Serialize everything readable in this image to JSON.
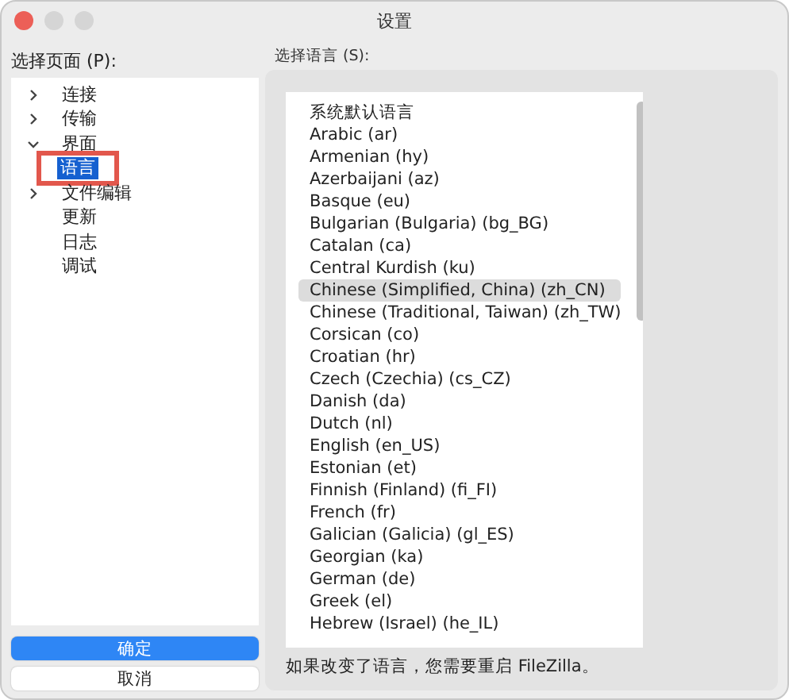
{
  "window": {
    "title": "设置"
  },
  "page_tree": {
    "label": "选择页面 (P):",
    "items": [
      {
        "label": "连接",
        "kind": "group",
        "expanded": false,
        "selected": false
      },
      {
        "label": "传输",
        "kind": "group",
        "expanded": false,
        "selected": false
      },
      {
        "label": "界面",
        "kind": "group",
        "expanded": true,
        "selected": false,
        "children": [
          {
            "label": "语言",
            "selected": true,
            "highlighted": true
          }
        ]
      },
      {
        "label": "文件编辑",
        "kind": "group",
        "expanded": false,
        "selected": false
      },
      {
        "label": "更新",
        "kind": "leaf",
        "selected": false
      },
      {
        "label": "日志",
        "kind": "leaf",
        "selected": false
      },
      {
        "label": "调试",
        "kind": "leaf",
        "selected": false
      }
    ]
  },
  "buttons": [
    {
      "label": "确定",
      "kind": "primary"
    },
    {
      "label": "取消",
      "kind": "default"
    }
  ],
  "language": {
    "label": "选择语言 (S):",
    "items": [
      {
        "label": "系统默认语言",
        "selected": false
      },
      {
        "label": "Arabic (ar)",
        "selected": false
      },
      {
        "label": "Armenian (hy)",
        "selected": false
      },
      {
        "label": "Azerbaijani (az)",
        "selected": false
      },
      {
        "label": "Basque (eu)",
        "selected": false
      },
      {
        "label": "Bulgarian (Bulgaria) (bg_BG)",
        "selected": false
      },
      {
        "label": "Catalan (ca)",
        "selected": false
      },
      {
        "label": "Central Kurdish (ku)",
        "selected": false
      },
      {
        "label": "Chinese (Simplified, China) (zh_CN)",
        "selected": true
      },
      {
        "label": "Chinese (Traditional, Taiwan) (zh_TW)",
        "selected": false
      },
      {
        "label": "Corsican (co)",
        "selected": false
      },
      {
        "label": "Croatian (hr)",
        "selected": false
      },
      {
        "label": "Czech (Czechia) (cs_CZ)",
        "selected": false
      },
      {
        "label": "Danish (da)",
        "selected": false
      },
      {
        "label": "Dutch (nl)",
        "selected": false
      },
      {
        "label": "English (en_US)",
        "selected": false
      },
      {
        "label": "Estonian (et)",
        "selected": false
      },
      {
        "label": "Finnish (Finland) (fi_FI)",
        "selected": false
      },
      {
        "label": "French (fr)",
        "selected": false
      },
      {
        "label": "Galician (Galicia) (gl_ES)",
        "selected": false
      },
      {
        "label": "Georgian (ka)",
        "selected": false
      },
      {
        "label": "German (de)",
        "selected": false
      },
      {
        "label": "Greek (el)",
        "selected": false
      },
      {
        "label": "Hebrew (Israel) (he_IL)",
        "selected": false
      }
    ],
    "note": "如果改变了语言，您需要重启 FileZilla。"
  }
}
